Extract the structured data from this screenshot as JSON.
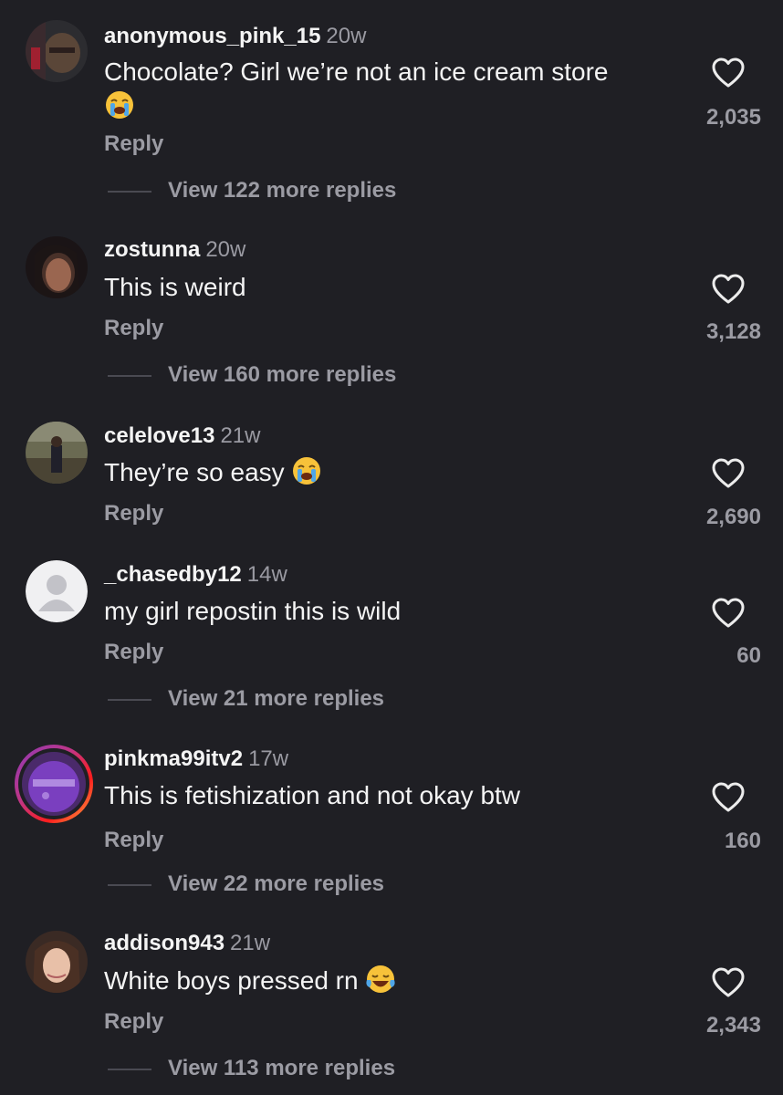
{
  "comments": [
    {
      "username": "anonymous_pink_15",
      "time": "20w",
      "text": "Chocolate? Girl we’re not an ice cream store",
      "emoji": "loudly-crying-face",
      "likes": "2,035",
      "reply": "Reply",
      "more": "View 122 more replies"
    },
    {
      "username": "zostunna",
      "time": "20w",
      "text": "This is weird",
      "likes": "3,128",
      "reply": "Reply",
      "more": "View 160 more replies"
    },
    {
      "username": "celelove13",
      "time": "21w",
      "text": "They’re so easy",
      "emoji": "loudly-crying-face",
      "likes": "2,690",
      "reply": "Reply"
    },
    {
      "username": "_chasedby12",
      "time": "14w",
      "text": "my girl repostin this is wild",
      "likes": "60",
      "reply": "Reply",
      "more": "View 21 more replies"
    },
    {
      "username": "pinkma99itv2",
      "time": "17w",
      "text": "This is fetishization and not okay btw",
      "likes": "160",
      "reply": "Reply",
      "more": "View 22 more replies"
    },
    {
      "username": "addison943",
      "time": "21w",
      "text": "White boys pressed rn",
      "emoji": "face-with-tears-of-joy",
      "likes": "2,343",
      "reply": "Reply",
      "more": "View 113 more replies"
    }
  ],
  "icons": {
    "like": "heart-outline-icon"
  },
  "colors": {
    "background": "#1f1f24",
    "muted": "#9b9ba3",
    "text": "#f4f4f4",
    "story_ring_start": "#c13584",
    "story_ring_end": "#fcaf45"
  }
}
